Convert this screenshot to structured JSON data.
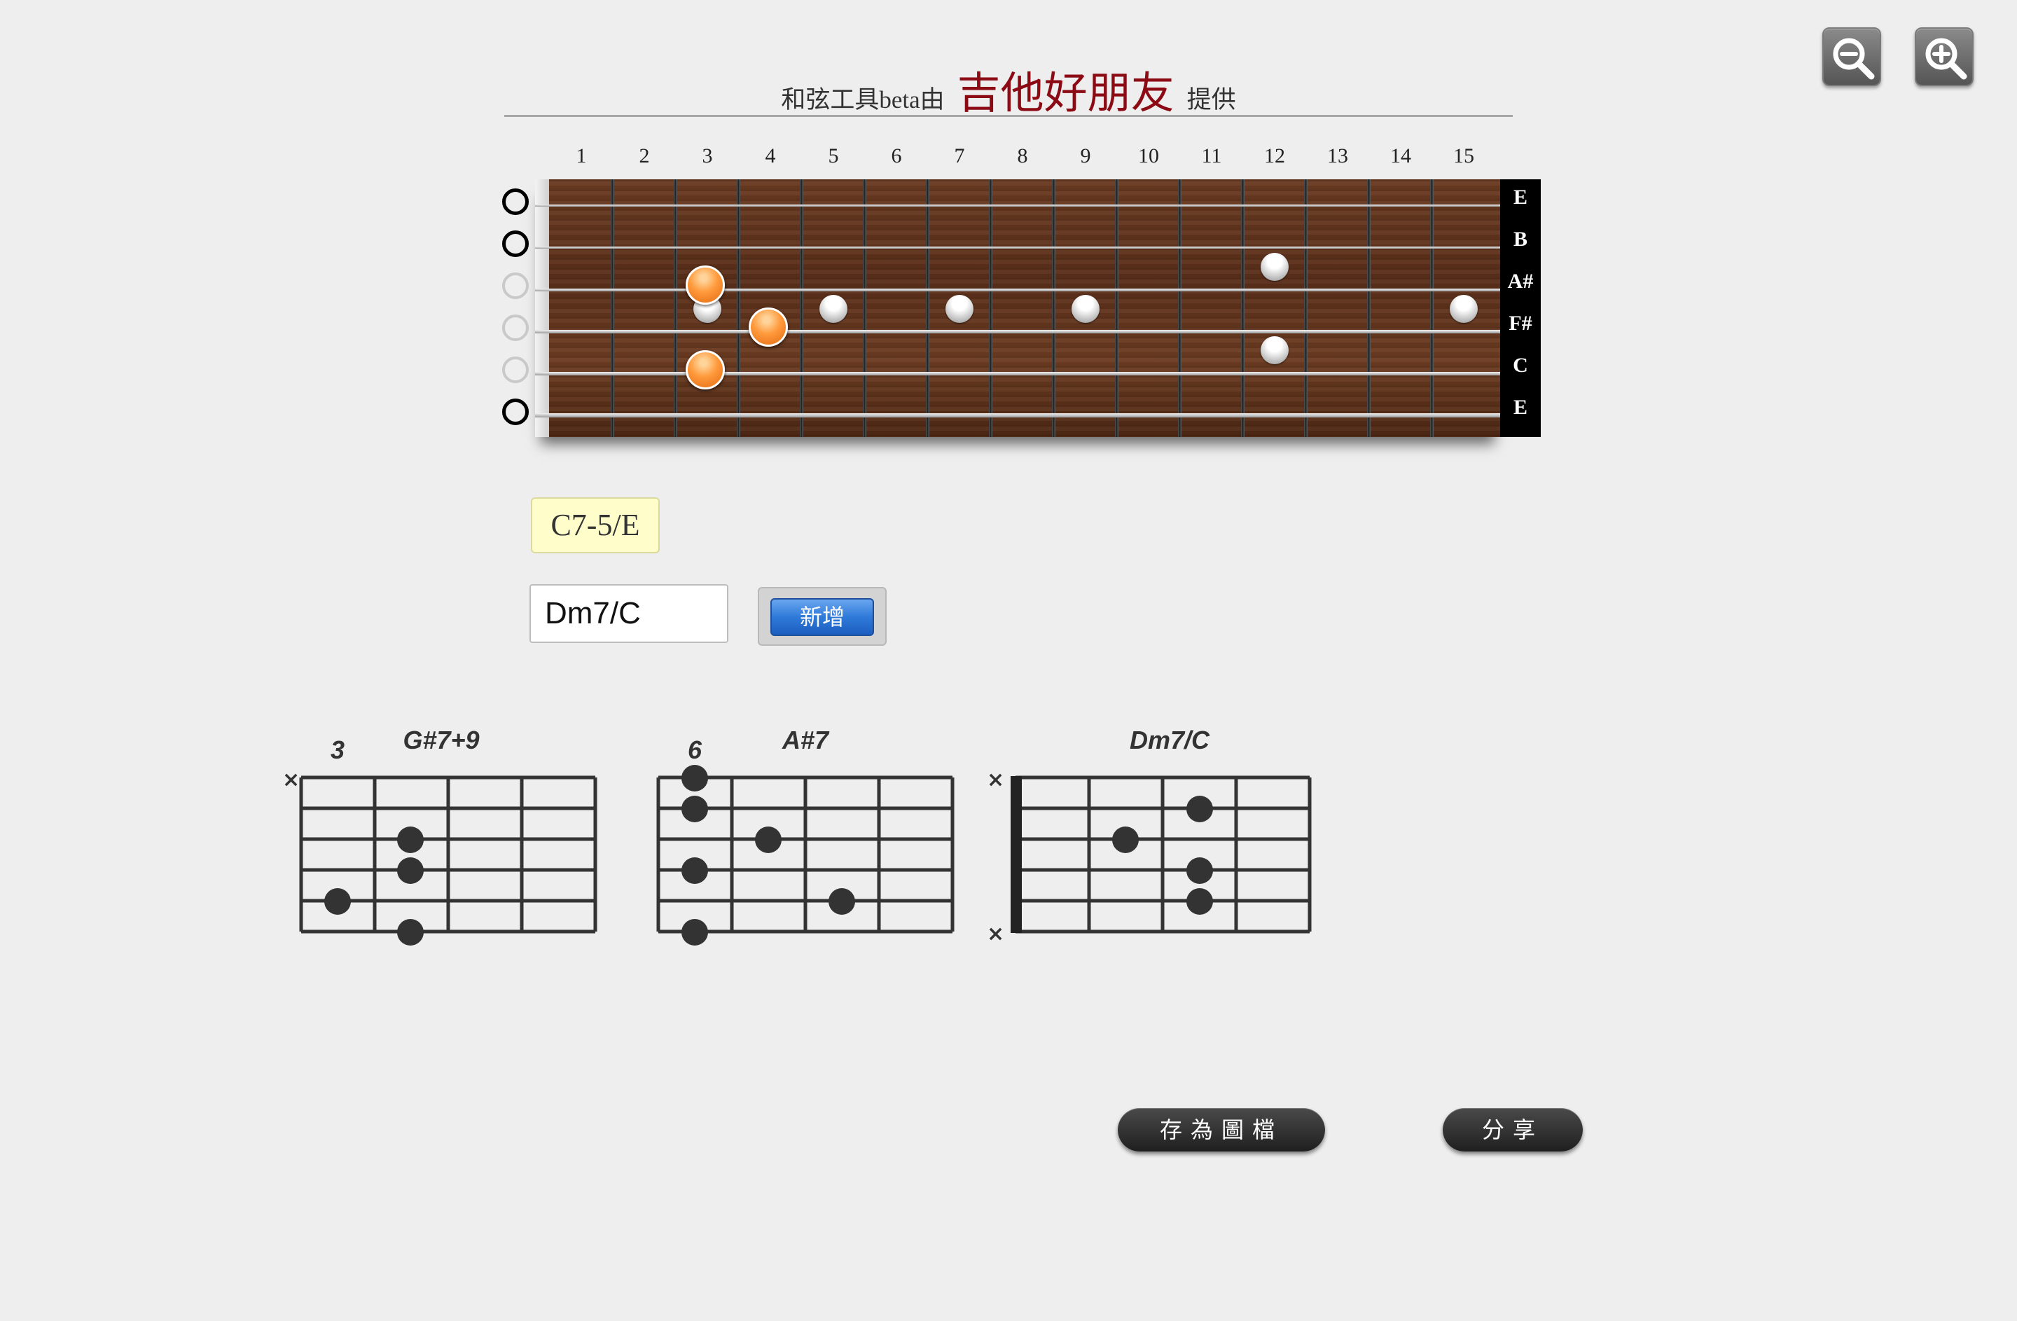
{
  "header": {
    "prefix": "和弦工具beta由",
    "brand": "吉他好朋友",
    "suffix": "提供"
  },
  "toolbar": {
    "zoom_out_icon": "zoom-out-icon",
    "zoom_in_icon": "zoom-in-icon"
  },
  "fretboard": {
    "fret_numbers": [
      "1",
      "2",
      "3",
      "4",
      "5",
      "6",
      "7",
      "8",
      "9",
      "10",
      "11",
      "12",
      "13",
      "14",
      "15"
    ],
    "string_labels": [
      "E",
      "B",
      "A#",
      "F#",
      "C",
      "E"
    ],
    "open_string_states": [
      "open",
      "open",
      "muted",
      "muted",
      "muted",
      "open"
    ],
    "fretted_notes": [
      {
        "string": 3,
        "fret": 3
      },
      {
        "string": 4,
        "fret": 4
      },
      {
        "string": 5,
        "fret": 3
      }
    ],
    "inlay_markers": [
      3,
      5,
      7,
      9,
      12,
      15
    ],
    "colors": {
      "note": "#ff9a3c",
      "wood": "#5a2f1a",
      "brand": "#8b0a14"
    }
  },
  "current_chord": "C7-5/E",
  "input": {
    "value": "Dm7/C",
    "add_label": "新增"
  },
  "diagrams": [
    {
      "name": "G#7+9",
      "fret_label": "3"
    },
    {
      "name": "A#7",
      "fret_label": "6"
    },
    {
      "name": "Dm7/C",
      "fret_label": ""
    }
  ],
  "actions": {
    "save_image": "存為圖檔",
    "share": "分享"
  }
}
